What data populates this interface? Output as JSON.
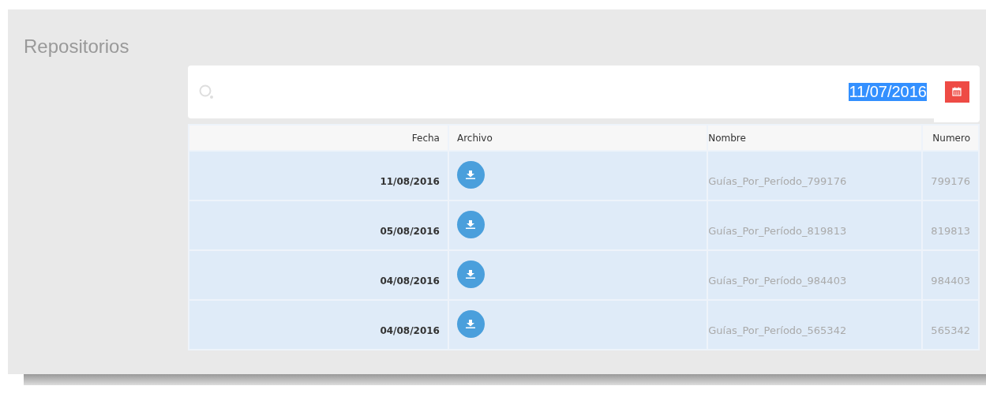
{
  "page_title": "Repositorios",
  "date_filter": {
    "value": "11/07/2016",
    "text_selected": true
  },
  "table": {
    "columns": [
      "Fecha",
      "Archivo",
      "Nombre",
      "Numero"
    ],
    "rows": [
      {
        "fecha": "11/08/2016",
        "nombre": "Guías_Por_Período_799176",
        "numero": "799176"
      },
      {
        "fecha": "05/08/2016",
        "nombre": "Guías_Por_Período_819813",
        "numero": "819813"
      },
      {
        "fecha": "04/08/2016",
        "nombre": "Guías_Por_Período_984403",
        "numero": "984403"
      },
      {
        "fecha": "04/08/2016",
        "nombre": "Guías_Por_Período_565342",
        "numero": "565342"
      }
    ]
  }
}
